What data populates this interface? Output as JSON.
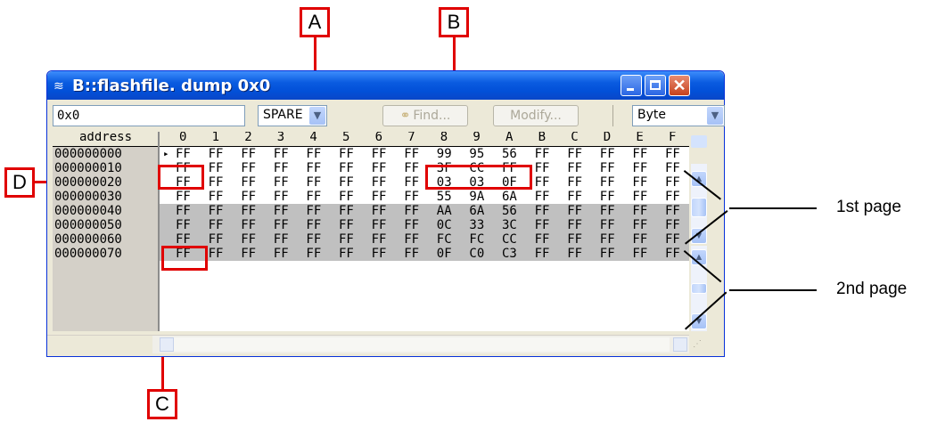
{
  "callouts": {
    "a": "A",
    "b": "B",
    "c": "C",
    "d": "D"
  },
  "window": {
    "title": "B::flashfile. dump 0x0",
    "title_icon": "dump-window-icon"
  },
  "toolbar": {
    "address_value": "0x0",
    "area_value": "SPARE",
    "find_label": "Find...",
    "modify_label": "Modify...",
    "format_value": "Byte"
  },
  "grid": {
    "address_header": "address",
    "columns": [
      "0",
      "1",
      "2",
      "3",
      "4",
      "5",
      "6",
      "7",
      "8",
      "9",
      "A",
      "B",
      "C",
      "D",
      "E",
      "F"
    ],
    "addresses": [
      "000000000",
      "000000010",
      "000000020",
      "000000030",
      "000000040",
      "000000050",
      "000000060",
      "000000070"
    ],
    "rows": [
      [
        "FF",
        "FF",
        "FF",
        "FF",
        "FF",
        "FF",
        "FF",
        "FF",
        "99",
        "95",
        "56",
        "FF",
        "FF",
        "FF",
        "FF",
        "FF"
      ],
      [
        "FF",
        "FF",
        "FF",
        "FF",
        "FF",
        "FF",
        "FF",
        "FF",
        "3F",
        "CC",
        "FF",
        "FF",
        "FF",
        "FF",
        "FF",
        "FF"
      ],
      [
        "FF",
        "FF",
        "FF",
        "FF",
        "FF",
        "FF",
        "FF",
        "FF",
        "03",
        "03",
        "0F",
        "FF",
        "FF",
        "FF",
        "FF",
        "FF"
      ],
      [
        "FF",
        "FF",
        "FF",
        "FF",
        "FF",
        "FF",
        "FF",
        "FF",
        "55",
        "9A",
        "6A",
        "FF",
        "FF",
        "FF",
        "FF",
        "FF"
      ],
      [
        "FF",
        "FF",
        "FF",
        "FF",
        "FF",
        "FF",
        "FF",
        "FF",
        "AA",
        "6A",
        "56",
        "FF",
        "FF",
        "FF",
        "FF",
        "FF"
      ],
      [
        "FF",
        "FF",
        "FF",
        "FF",
        "FF",
        "FF",
        "FF",
        "FF",
        "0C",
        "33",
        "3C",
        "FF",
        "FF",
        "FF",
        "FF",
        "FF"
      ],
      [
        "FF",
        "FF",
        "FF",
        "FF",
        "FF",
        "FF",
        "FF",
        "FF",
        "FC",
        "FC",
        "CC",
        "FF",
        "FF",
        "FF",
        "FF",
        "FF"
      ],
      [
        "FF",
        "FF",
        "FF",
        "FF",
        "FF",
        "FF",
        "FF",
        "FF",
        "0F",
        "C0",
        "C3",
        "FF",
        "FF",
        "FF",
        "FF",
        "FF"
      ]
    ],
    "cursor_marker": "▸"
  },
  "annotations": {
    "first_page": "1st page",
    "second_page": "2nd page"
  },
  "colors": {
    "highlight_red": "#e00000",
    "second_page_bg": "#c0c0c0",
    "titlebar_blue": "#0a5be0"
  }
}
